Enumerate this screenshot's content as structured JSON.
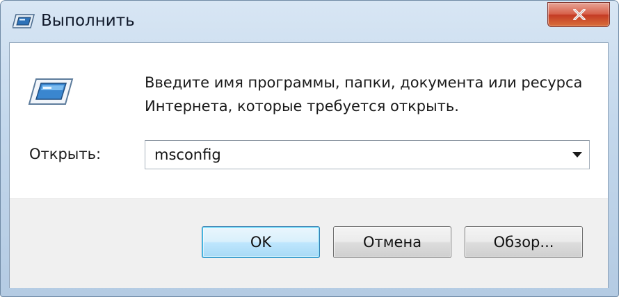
{
  "window": {
    "title": "Выполнить"
  },
  "instruction": "Введите имя программы, папки, документа или ресурса Интернета, которые требуется открыть.",
  "open": {
    "label": "Открыть:",
    "value": "msconfig"
  },
  "buttons": {
    "ok": "OK",
    "cancel": "Отмена",
    "browse": "Обзор..."
  },
  "icons": {
    "title": "run-app-icon",
    "main": "run-app-icon",
    "close": "close-icon",
    "dropdown": "chevron-down-icon"
  },
  "colors": {
    "frame": "#c4d8ec",
    "close_button": "#c43b24",
    "default_button_border": "#3c7fb1",
    "footer": "#f0f0f0"
  }
}
